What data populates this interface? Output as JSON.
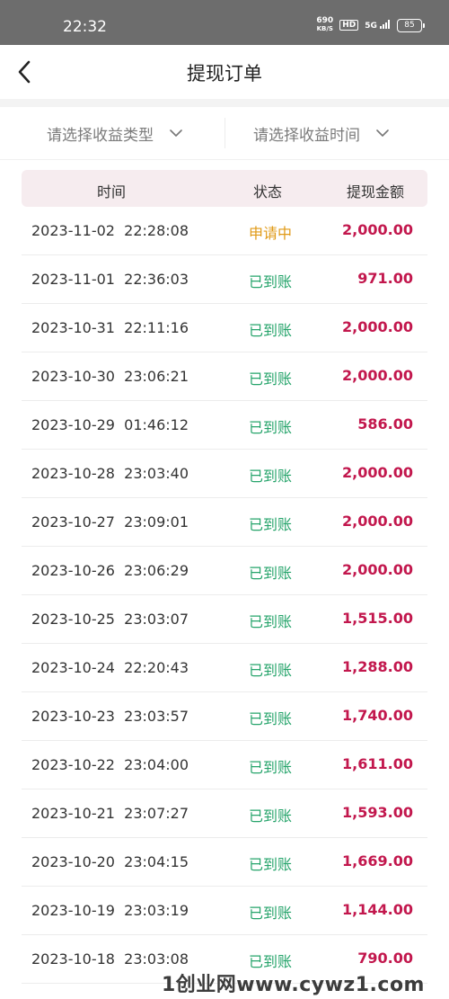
{
  "status_bar": {
    "time": "22:32",
    "net_speed_value": "690",
    "net_speed_unit": "KB/S",
    "hd": "HD",
    "network": "5G",
    "battery": "85"
  },
  "header": {
    "title": "提现订单",
    "back_icon": "chevron-left-icon"
  },
  "filters": {
    "type_placeholder": "请选择收益类型",
    "time_placeholder": "请选择收益时间",
    "dropdown_icon": "chevron-down-icon"
  },
  "table": {
    "columns": [
      "时间",
      "状态",
      "提现金额"
    ],
    "status_colors": {
      "申请中": "#e09a16",
      "已到账": "#26a46b"
    },
    "amount_color": "#c2174d",
    "rows": [
      {
        "time": "2023-11-02  22:28:08",
        "status": "申请中",
        "amount": "2,000.00"
      },
      {
        "time": "2023-11-01  22:36:03",
        "status": "已到账",
        "amount": "971.00"
      },
      {
        "time": "2023-10-31  22:11:16",
        "status": "已到账",
        "amount": "2,000.00"
      },
      {
        "time": "2023-10-30  23:06:21",
        "status": "已到账",
        "amount": "2,000.00"
      },
      {
        "time": "2023-10-29  01:46:12",
        "status": "已到账",
        "amount": "586.00"
      },
      {
        "time": "2023-10-28  23:03:40",
        "status": "已到账",
        "amount": "2,000.00"
      },
      {
        "time": "2023-10-27  23:09:01",
        "status": "已到账",
        "amount": "2,000.00"
      },
      {
        "time": "2023-10-26  23:06:29",
        "status": "已到账",
        "amount": "2,000.00"
      },
      {
        "time": "2023-10-25  23:03:07",
        "status": "已到账",
        "amount": "1,515.00"
      },
      {
        "time": "2023-10-24  22:20:43",
        "status": "已到账",
        "amount": "1,288.00"
      },
      {
        "time": "2023-10-23  23:03:57",
        "status": "已到账",
        "amount": "1,740.00"
      },
      {
        "time": "2023-10-22  23:04:00",
        "status": "已到账",
        "amount": "1,611.00"
      },
      {
        "time": "2023-10-21  23:07:27",
        "status": "已到账",
        "amount": "1,593.00"
      },
      {
        "time": "2023-10-20  23:04:15",
        "status": "已到账",
        "amount": "1,669.00"
      },
      {
        "time": "2023-10-19  23:03:19",
        "status": "已到账",
        "amount": "1,144.00"
      },
      {
        "time": "2023-10-18  23:03:08",
        "status": "已到账",
        "amount": "790.00"
      }
    ]
  },
  "watermark": "1创业网www.cywz1.com"
}
